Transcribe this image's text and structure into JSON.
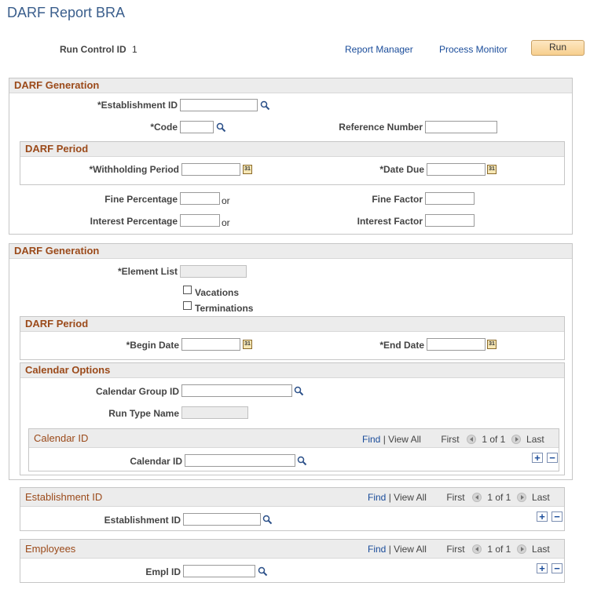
{
  "page": {
    "title": "DARF Report BRA"
  },
  "header": {
    "run_control_label": "Run Control ID",
    "run_control_value": "1",
    "report_manager": "Report Manager",
    "process_monitor": "Process Monitor",
    "run_button": "Run"
  },
  "gen1": {
    "title": "DARF Generation",
    "establishment_label": "*Establishment ID",
    "code_label": "*Code",
    "reference_label": "Reference Number",
    "period": {
      "title": "DARF Period",
      "withholding_label": "*Withholding Period",
      "date_due_label": "*Date Due"
    },
    "fine_pct_label": "Fine Percentage",
    "or_text": "or",
    "fine_factor_label": "Fine Factor",
    "interest_pct_label": "Interest Percentage",
    "interest_factor_label": "Interest Factor"
  },
  "gen2": {
    "title": "DARF Generation",
    "element_list_label": "*Element List",
    "vacations_label": "Vacations",
    "terminations_label": "Terminations",
    "period": {
      "title": "DARF Period",
      "begin_label": "*Begin Date",
      "end_label": "*End Date"
    },
    "calendar_options": {
      "title": "Calendar Options",
      "group_label": "Calendar Group ID",
      "run_type_label": "Run Type Name",
      "grid": {
        "title": "Calendar ID",
        "field_label": "Calendar ID"
      }
    }
  },
  "nav": {
    "find": "Find",
    "sep": "|",
    "view_all": "View All",
    "first": "First",
    "count": "1 of 1",
    "last": "Last"
  },
  "establishment_grid": {
    "title": "Establishment ID",
    "field_label": "Establishment ID"
  },
  "employees_grid": {
    "title": "Employees",
    "field_label": "Empl ID"
  }
}
